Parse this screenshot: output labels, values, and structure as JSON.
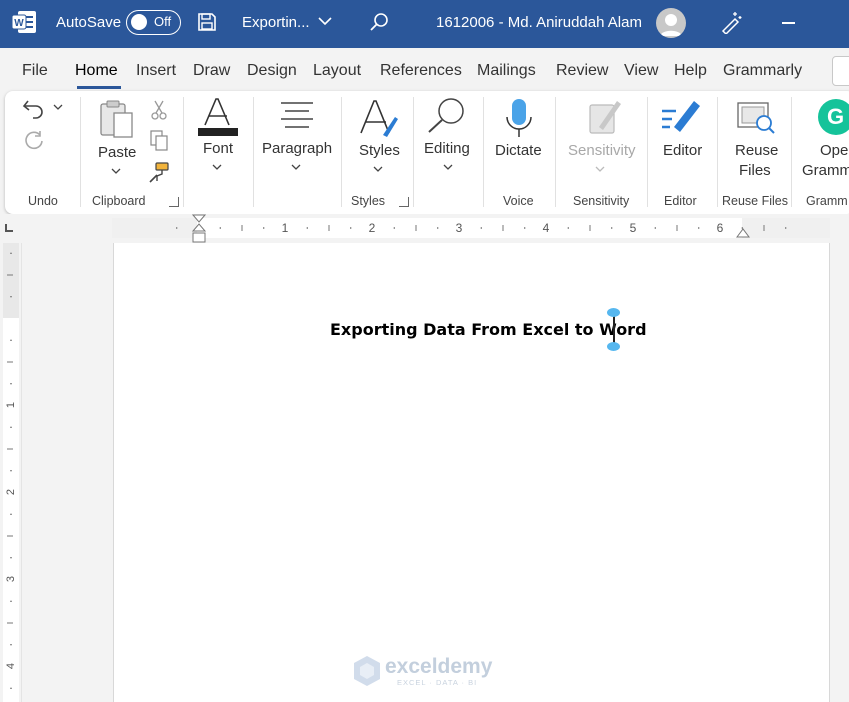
{
  "titlebar": {
    "autosave_label": "AutoSave",
    "autosave_state": "Off",
    "doc_title": "Exportin...",
    "user_name": "1612006 - Md. Aniruddah Alam"
  },
  "menu": {
    "tabs": [
      "File",
      "Home",
      "Insert",
      "Draw",
      "Design",
      "Layout",
      "References",
      "Mailings",
      "Review",
      "View",
      "Help",
      "Grammarly"
    ],
    "active": "Home"
  },
  "ribbon": {
    "undo_group": "Undo",
    "paste": "Paste",
    "clipboard_group": "Clipboard",
    "font": "Font",
    "paragraph": "Paragraph",
    "styles": "Styles",
    "styles_group": "Styles",
    "editing": "Editing",
    "dictate": "Dictate",
    "voice_group": "Voice",
    "sensitivity": "Sensitivity",
    "sensitivity_group": "Sensitivity",
    "editor": "Editor",
    "editor_group": "Editor",
    "reuse_line1": "Reuse",
    "reuse_line2": "Files",
    "reuse_group": "Reuse Files",
    "grammarly_line1": "Ope",
    "grammarly_line2": "Gramm",
    "grammarly_group": "Gramm"
  },
  "ruler": {
    "h_numbers": [
      "1",
      "2",
      "3",
      "4",
      "5",
      "6"
    ],
    "v_numbers": [
      "1",
      "2",
      "3",
      "4"
    ]
  },
  "document": {
    "heading": "Exporting Data From Excel to Word"
  },
  "watermark": {
    "brand": "exceldemy",
    "tagline": "EXCEL · DATA · BI"
  },
  "colors": {
    "titlebar": "#2b579a",
    "accent": "#2b579a",
    "grammarly": "#15c39a",
    "selection_handle": "#56b7ef"
  }
}
